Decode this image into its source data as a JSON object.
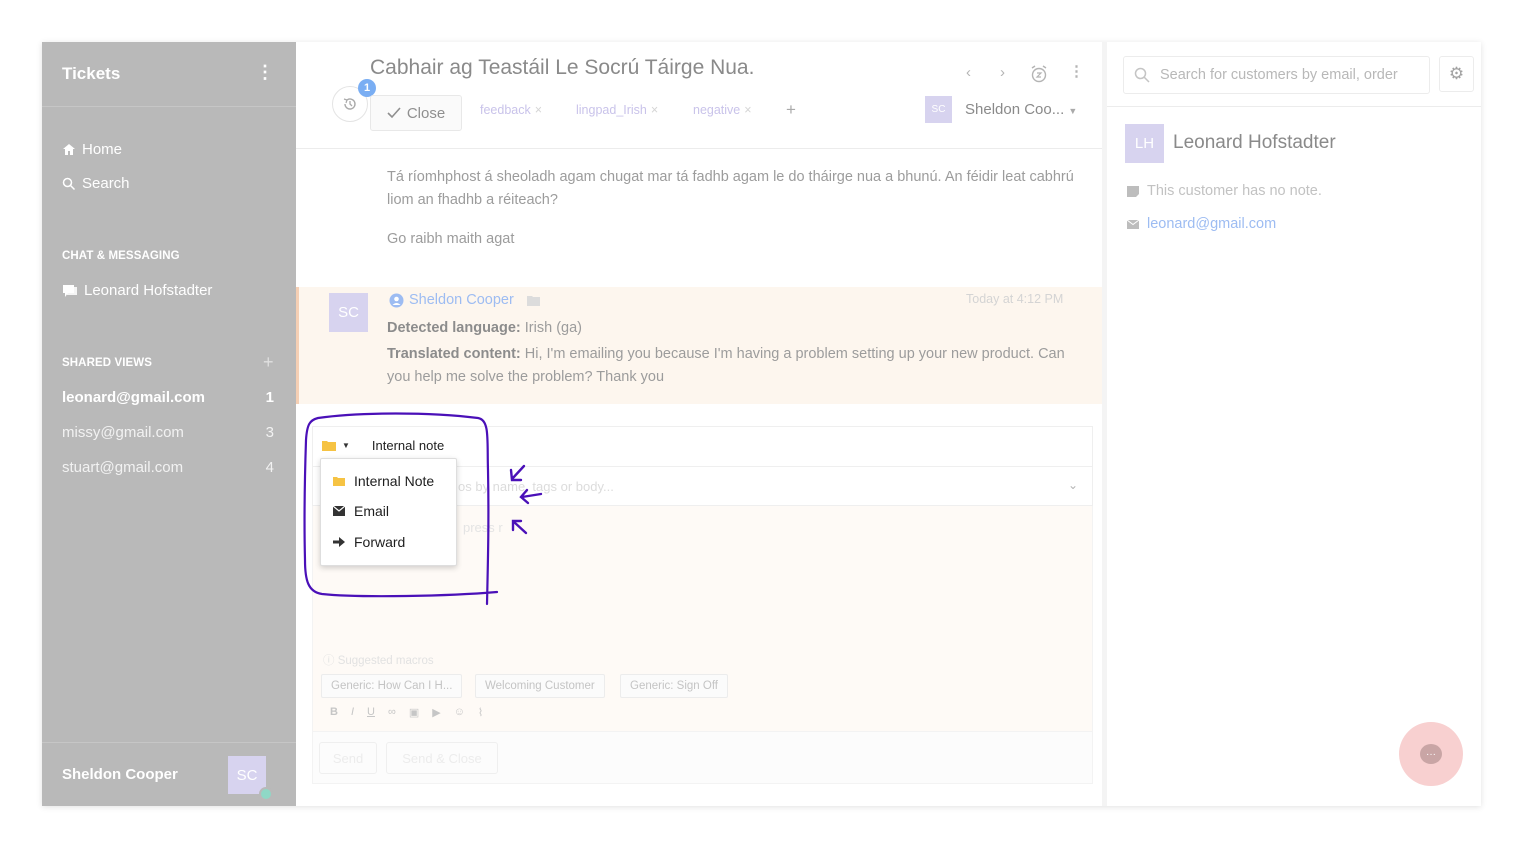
{
  "sidebar": {
    "title": "Tickets",
    "nav": [
      {
        "label": "Home"
      },
      {
        "label": "Search"
      }
    ],
    "chat_section": "CHAT & MESSAGING",
    "chat_items": [
      {
        "label": "Leonard Hofstadter"
      }
    ],
    "views_section": "SHARED VIEWS",
    "views": [
      {
        "label": "leonard@gmail.com",
        "count": "1"
      },
      {
        "label": "missy@gmail.com",
        "count": "3"
      },
      {
        "label": "stuart@gmail.com",
        "count": "4"
      }
    ],
    "user_name": "Sheldon Cooper",
    "user_initials": "SC"
  },
  "ticket": {
    "title": "Cabhair ag Teastáil Le Socrú Táirge Nua.",
    "history_badge": "1",
    "close_label": "Close",
    "tags": [
      "feedback",
      "lingpad_Irish",
      "negative"
    ],
    "assignee_initials": "SC",
    "assignee_name": "Sheldon Coo..."
  },
  "messages": {
    "body1": "Tá ríomhphost á sheoladh agam chugat mar tá fadhb agam le do tháirge nua a bhunú. An féidir leat cabhrú liom an fhadhb a réiteach?",
    "body2": "Go raibh maith agat"
  },
  "note": {
    "initials": "SC",
    "author": "Sheldon Cooper",
    "time": "Today at 4:12 PM",
    "lang_label": "Detected language:",
    "lang_value": "Irish (ga)",
    "trans_label": "Translated content:",
    "trans_value": "Hi, I'm emailing you because I'm having a problem setting up your new product. Can you help me solve the problem? Thank you"
  },
  "composer": {
    "mode_label": "Internal note",
    "search_placeholder": "os by name, tags or body...",
    "body_hint": "press r",
    "suggested_label": "Suggested macros",
    "macros": [
      "Generic: How Can I H...",
      "Welcoming Customer",
      "Generic: Sign Off"
    ],
    "toolbar": [
      "B",
      "I",
      "U"
    ],
    "send_label": "Send",
    "send_close_label": "Send & Close"
  },
  "dropdown": {
    "items": [
      {
        "label": "Internal Note"
      },
      {
        "label": "Email"
      },
      {
        "label": "Forward"
      }
    ]
  },
  "customer": {
    "search_placeholder": "Search for customers by email, order",
    "initials": "LH",
    "name": "Leonard Hofstadter",
    "note": "This customer has no note.",
    "email": "leonard@gmail.com"
  },
  "colors": {
    "annotation": "#4a10b8",
    "sidebar_bg": "#b9b9b9",
    "accent_link": "#9dbcf2",
    "note_folder": "#f6c343"
  }
}
